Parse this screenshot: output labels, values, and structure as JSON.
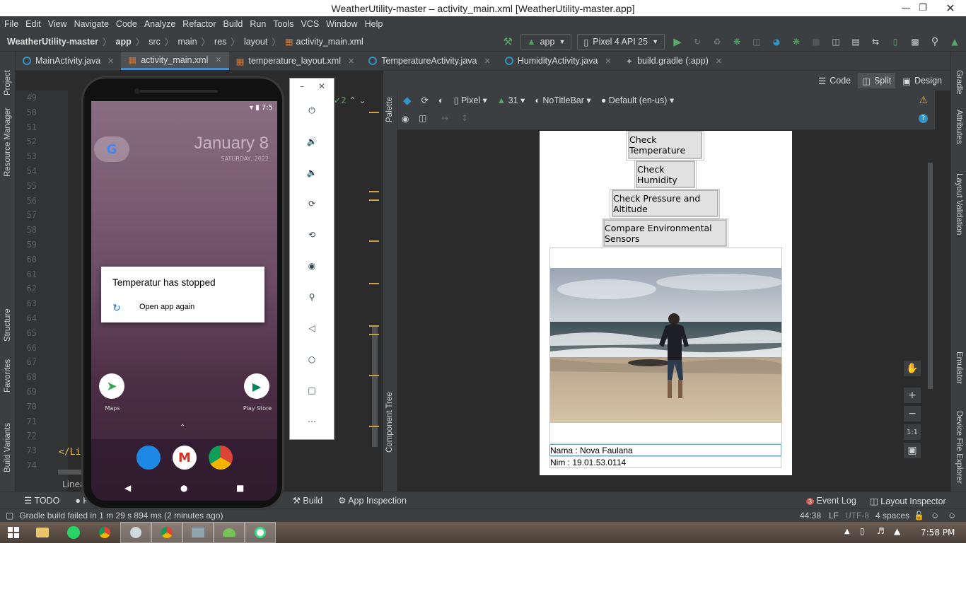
{
  "window": {
    "title": "WeatherUtility-master – activity_main.xml [WeatherUtility-master.app]"
  },
  "menu": [
    "File",
    "Edit",
    "View",
    "Navigate",
    "Code",
    "Analyze",
    "Refactor",
    "Build",
    "Run",
    "Tools",
    "VCS",
    "Window",
    "Help"
  ],
  "breadcrumb": {
    "project": "WeatherUtility-master",
    "module": "app",
    "p1": "src",
    "p2": "main",
    "p3": "res",
    "p4": "layout",
    "file": "activity_main.xml"
  },
  "toolbar": {
    "config": "app",
    "device": "Pixel 4 API 25"
  },
  "tabs": [
    {
      "label": "MainActivity.java"
    },
    {
      "label": "activity_main.xml"
    },
    {
      "label": "temperature_layout.xml"
    },
    {
      "label": "TemperatureActivity.java"
    },
    {
      "label": "HumidityActivity.java"
    },
    {
      "label": "build.gradle (:app)"
    }
  ],
  "left_tools": {
    "project": "Project",
    "resource": "Resource Manager",
    "structure": "Structure",
    "favorites": "Favorites",
    "variants": "Build Variants"
  },
  "right_tools": {
    "gradle": "Gradle",
    "attributes": "Attributes",
    "validation": "Layout Validation",
    "emulator": "Emulator",
    "explorer": "Device File Explorer"
  },
  "editor": {
    "line_numbers": [
      "49",
      "50",
      "51",
      "52",
      "53",
      "54",
      "55",
      "56",
      "57",
      "58",
      "59",
      "60",
      "61",
      "62",
      "63",
      "64",
      "65",
      "66",
      "67",
      "68",
      "69",
      "70",
      "71",
      "72",
      "73",
      "74"
    ],
    "code_line": "</Li",
    "warn_count": "2",
    "crumb_bottom": "Linea"
  },
  "modes": {
    "code": "Code",
    "split": "Split",
    "design": "Design"
  },
  "design_toolbar": {
    "device": "Pixel",
    "api": "31",
    "theme": "NoTitleBar",
    "locale": "Default (en-us)"
  },
  "palette": {
    "palette": "Palette",
    "tree": "Component Tree"
  },
  "app_layout": {
    "buttons": [
      "Check Temperature",
      "Check Humidity",
      "Check Pressure and Altitude",
      "Compare Environmental Sensors"
    ],
    "nama": "Nama : Nova Faulana",
    "nim": "Nim : 19.01.53.0114"
  },
  "zoom": {
    "fit": "1:1"
  },
  "phone": {
    "time": "7:5",
    "date": "January 8",
    "date_sub": "SATURDAY, 2022",
    "dialog_title": "Temperatur has stopped",
    "dialog_action": "Open app again",
    "maps": "Maps",
    "play": "Play Store"
  },
  "bottom_tools": {
    "todo": "TODO",
    "problems": "P",
    "build": "Build",
    "inspection": "App Inspection",
    "event_count": "3",
    "event": "Event Log",
    "layout_inspector": "Layout Inspector"
  },
  "status": {
    "message": "Gradle build failed in 1 m 29 s 894 ms (2 minutes ago)",
    "pos": "44:38",
    "lf": "LF",
    "enc": "UTF-8",
    "indent": "4 spaces"
  },
  "taskbar": {
    "clock": "7:58 PM"
  },
  "colors": {
    "ide_bg": "#2b2b2b",
    "panel": "#3c3f41",
    "accent": "#4a88c7",
    "run_green": "#59a869"
  }
}
